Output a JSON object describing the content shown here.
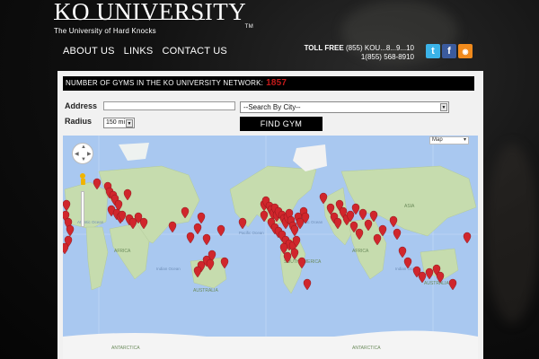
{
  "header": {
    "logo_title": "KO UNIVERSITY",
    "logo_tm": "TM",
    "logo_subtitle": "The University of Hard Knocks"
  },
  "nav": {
    "items": [
      {
        "label": "ABOUT US"
      },
      {
        "label": "LINKS"
      },
      {
        "label": "CONTACT US"
      }
    ]
  },
  "contact": {
    "toll_free_label": "TOLL FREE",
    "toll_free_number": "(855) KOU...8...9...10",
    "phone": "1(855) 568-8910"
  },
  "social": {
    "icons": [
      "twitter-icon",
      "facebook-icon",
      "rss-icon"
    ],
    "twitter_glyph": "t",
    "facebook_glyph": "f",
    "rss_glyph": "◉"
  },
  "search": {
    "count_label": "NUMBER OF GYMS IN THE KO UNIVERSITY NETWORK:",
    "count_value": "1857",
    "address_label": "Address",
    "address_value": "",
    "city_select_value": "--Search By City--",
    "radius_label": "Radius",
    "radius_value": "150 mi",
    "find_button": "FIND GYM"
  },
  "map": {
    "map_type": "Map",
    "labels": {
      "africa_1": "AFRICA",
      "africa_2": "AFRICA",
      "south_america": "SOUTH AMERICA",
      "australia_1": "AUSTRALIA",
      "australia_2": "AUSTRALIA",
      "asia": "ASIA",
      "antarctica_1": "ANTARCTICA",
      "antarctica_2": "ANTARCTICA",
      "indian_ocean_1": "Indian Ocean",
      "indian_ocean_2": "Indian Ocean",
      "atlantic_1": "Atlantic Ocean",
      "atlantic_2": "Atlantic Ocean",
      "pacific": "Pacific Ocean"
    },
    "colors": {
      "water": "#a9c8f0",
      "land": "#c6dcae",
      "ice": "#f4f4f4",
      "marker": "#d0262c"
    }
  }
}
